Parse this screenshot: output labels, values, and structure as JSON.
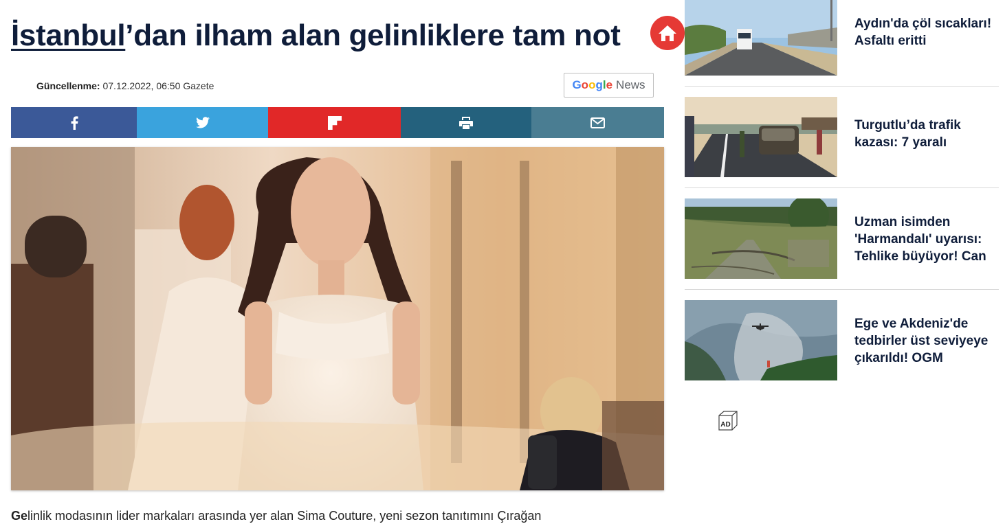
{
  "article": {
    "title_keyword": "İstanbul",
    "title_rest": "’dan ilham alan gelinliklere tam not",
    "updated_label": "Güncellenme:",
    "updated_value": "07.12.2022, 06:50 Gazete",
    "lead_first": "Ge",
    "lead_rest": "linlik modasının lider markaları arasında yer alan Sima Couture, yeni sezon tanıtımını Çırağan"
  },
  "google_news": {
    "google": "Google",
    "news": "News"
  },
  "share": [
    {
      "name": "facebook",
      "icon": "facebook-icon",
      "color": "#3b5998"
    },
    {
      "name": "twitter",
      "icon": "twitter-icon",
      "color": "#3aa3dd"
    },
    {
      "name": "flipboard",
      "icon": "flipboard-icon",
      "color": "#e12828"
    },
    {
      "name": "print",
      "icon": "print-icon",
      "color": "#24617d"
    },
    {
      "name": "email",
      "icon": "mail-icon",
      "color": "#4a7d92"
    }
  ],
  "sidebar": {
    "items": [
      {
        "title": "Aydın'da çöl sıcakları! Asfaltı eritti"
      },
      {
        "title": "Turgutlu’da trafik kazası: 7 yaralı"
      },
      {
        "title": "Uzman isimden 'Harmandalı' uyarısı: Tehlike büyüyor! Can"
      },
      {
        "title": "Ege ve Akdeniz'de tedbirler üst seviyeye çıkarıldı! OGM"
      }
    ]
  },
  "ad_badge": "AD",
  "colors": {
    "navy": "#0f1d3a",
    "home": "#e53935"
  }
}
